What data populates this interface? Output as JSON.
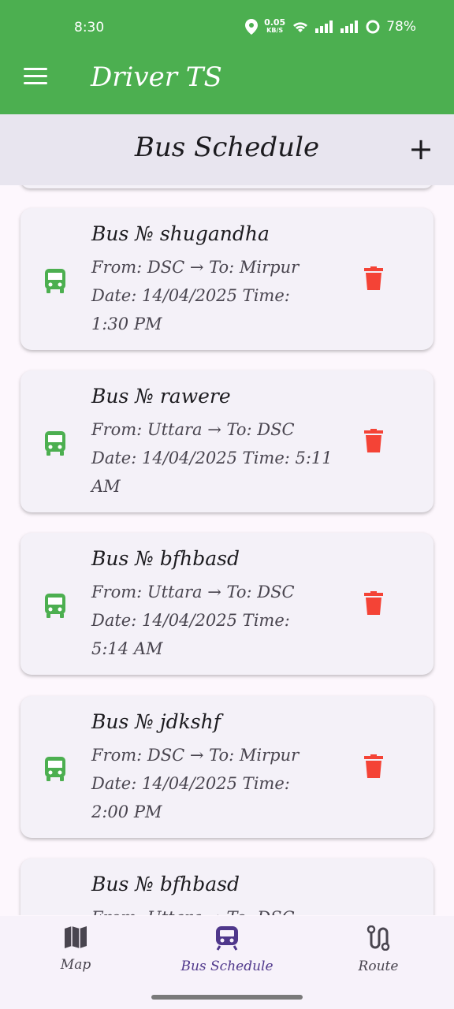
{
  "status_bar": {
    "time": "8:30",
    "speed_value": "0.05",
    "speed_unit": "KB/S",
    "battery": "78%"
  },
  "app_bar": {
    "title": "Driver TS"
  },
  "header": {
    "title": "Bus Schedule",
    "add_label": "+"
  },
  "schedules": [
    {
      "bus": "Bus № shugandha",
      "route": "From: DSC → To: Mirpur",
      "datetime": "Date: 14/04/2025 Time:",
      "datetime2": "1:30 PM"
    },
    {
      "bus": "Bus № rawere",
      "route": "From: Uttara → To: DSC",
      "datetime": "Date: 14/04/2025 Time: 5:11",
      "datetime2": "AM"
    },
    {
      "bus": "Bus № bfhbasd",
      "route": "From: Uttara → To: DSC",
      "datetime": "Date: 14/04/2025 Time:",
      "datetime2": "5:14 AM"
    },
    {
      "bus": "Bus № jdkshf",
      "route": "From: DSC → To: Mirpur",
      "datetime": "Date: 14/04/2025 Time:",
      "datetime2": "2:00 PM"
    },
    {
      "bus": "Bus № bfhbasd",
      "route": "From: Uttara → To: DSC",
      "datetime": "",
      "datetime2": ""
    }
  ],
  "bottom_nav": [
    {
      "label": "Map",
      "icon": "map-icon"
    },
    {
      "label": "Bus Schedule",
      "icon": "train-icon",
      "active": true
    },
    {
      "label": "Route",
      "icon": "route-icon"
    }
  ],
  "colors": {
    "primary": "#4caf50",
    "accent": "#4f378b",
    "delete": "#f44336",
    "bus_icon": "#4caf50"
  }
}
